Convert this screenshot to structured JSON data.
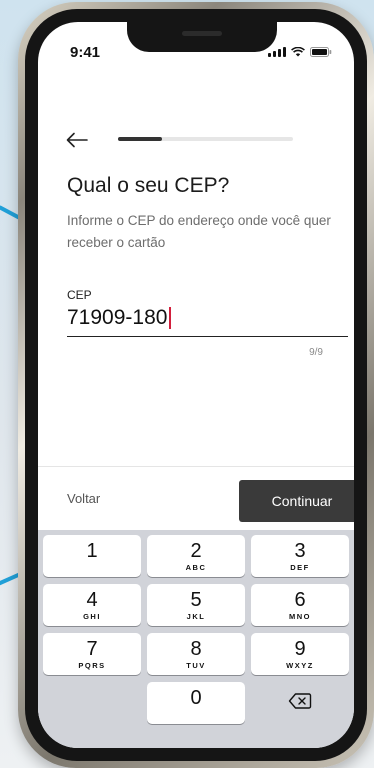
{
  "status_bar": {
    "time": "9:41"
  },
  "progress": {
    "fraction": 0.25
  },
  "page": {
    "title": "Qual o seu CEP?",
    "subtitle": "Informe o CEP do endereço onde você quer receber o cartão"
  },
  "cep_field": {
    "label": "CEP",
    "value": "71909-180",
    "counter": "9/9"
  },
  "actions": {
    "back_label": "Voltar",
    "continue_label": "Continuar"
  },
  "keypad": {
    "keys": [
      {
        "number": "1",
        "letters": ""
      },
      {
        "number": "2",
        "letters": "ABC"
      },
      {
        "number": "3",
        "letters": "DEF"
      },
      {
        "number": "4",
        "letters": "GHI"
      },
      {
        "number": "5",
        "letters": "JKL"
      },
      {
        "number": "6",
        "letters": "MNO"
      },
      {
        "number": "7",
        "letters": "PQRS"
      },
      {
        "number": "8",
        "letters": "TUV"
      },
      {
        "number": "9",
        "letters": "WXYZ"
      },
      {
        "number": "0",
        "letters": ""
      }
    ],
    "delete_icon": "backspace-icon"
  },
  "colors": {
    "accent_caret": "#d21f3c",
    "primary_button": "#3a3a3a",
    "decor_blue": "#21a0d8"
  }
}
